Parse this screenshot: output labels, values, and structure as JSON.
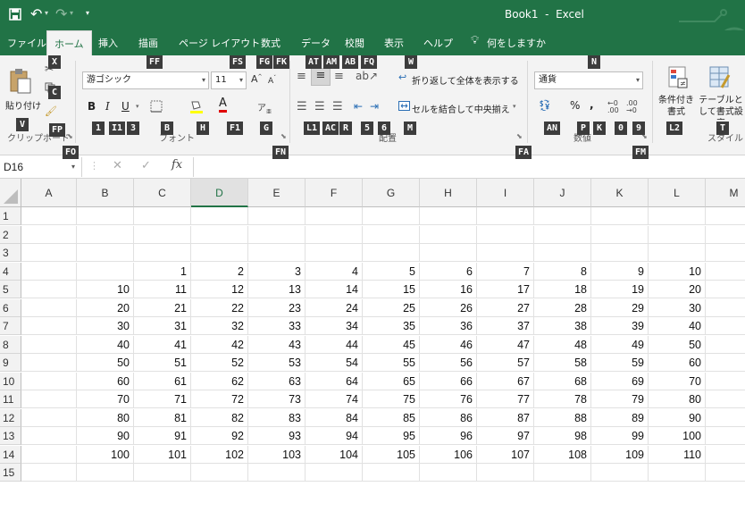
{
  "window": {
    "title": "Book1  -  Excel"
  },
  "menu": {
    "items": [
      "ファイル",
      "ホーム",
      "挿入",
      "描画",
      "ページ レイアウト",
      "数式",
      "データ",
      "校閲",
      "表示",
      "ヘルプ"
    ],
    "search": "何をしますか"
  },
  "keytips": {
    "menu": [
      "FF",
      "FS",
      "FG",
      "FK",
      "AT",
      "AM",
      "AB",
      "FQ",
      "W",
      "N"
    ],
    "ribbon": [
      "X",
      "C",
      "FP",
      "V",
      "1",
      "I1",
      "3",
      "B",
      "H",
      "F1",
      "G",
      "FN",
      "L1",
      "AC",
      "R",
      "5",
      "6",
      "M",
      "FA",
      "AN",
      "P",
      "K",
      "0",
      "9",
      "FM",
      "L2",
      "T",
      "FO"
    ]
  },
  "ribbon": {
    "clipboard": {
      "paste": "貼り付け",
      "label": "クリップボード"
    },
    "font": {
      "name": "游ゴシック",
      "size": "11",
      "label": "フォント"
    },
    "alignment": {
      "wrap": "折り返して全体を表示する",
      "merge": "セルを結合して中央揃え",
      "label": "配置"
    },
    "number": {
      "format": "通貨",
      "label": "数値"
    },
    "styles": {
      "conditional": "条件付き書式",
      "table": "テーブルとして書式設定",
      "label": "スタイル"
    }
  },
  "formula_bar": {
    "name_box": "D16",
    "fx": "fx",
    "value": ""
  },
  "sheet": {
    "columns": [
      "A",
      "B",
      "C",
      "D",
      "E",
      "F",
      "G",
      "H",
      "I",
      "J",
      "K",
      "L",
      "M"
    ],
    "selected_column": "D",
    "row_numbers": [
      "1",
      "2",
      "3",
      "4",
      "5",
      "6",
      "7",
      "8",
      "9",
      "10",
      "11",
      "12",
      "13",
      "14",
      "15"
    ],
    "cells": [
      [],
      [],
      [],
      [
        "",
        "",
        "1",
        "2",
        "3",
        "4",
        "5",
        "6",
        "7",
        "8",
        "9",
        "10"
      ],
      [
        "",
        "10",
        "11",
        "12",
        "13",
        "14",
        "15",
        "16",
        "17",
        "18",
        "19",
        "20"
      ],
      [
        "",
        "20",
        "21",
        "22",
        "23",
        "24",
        "25",
        "26",
        "27",
        "28",
        "29",
        "30"
      ],
      [
        "",
        "30",
        "31",
        "32",
        "33",
        "34",
        "35",
        "36",
        "37",
        "38",
        "39",
        "40"
      ],
      [
        "",
        "40",
        "41",
        "42",
        "43",
        "44",
        "45",
        "46",
        "47",
        "48",
        "49",
        "50"
      ],
      [
        "",
        "50",
        "51",
        "52",
        "53",
        "54",
        "55",
        "56",
        "57",
        "58",
        "59",
        "60"
      ],
      [
        "",
        "60",
        "61",
        "62",
        "63",
        "64",
        "65",
        "66",
        "67",
        "68",
        "69",
        "70"
      ],
      [
        "",
        "70",
        "71",
        "72",
        "73",
        "74",
        "75",
        "76",
        "77",
        "78",
        "79",
        "80"
      ],
      [
        "",
        "80",
        "81",
        "82",
        "83",
        "84",
        "85",
        "86",
        "87",
        "88",
        "89",
        "90"
      ],
      [
        "",
        "90",
        "91",
        "92",
        "93",
        "94",
        "95",
        "96",
        "97",
        "98",
        "99",
        "100"
      ],
      [
        "",
        "100",
        "101",
        "102",
        "103",
        "104",
        "105",
        "106",
        "107",
        "108",
        "109",
        "110"
      ],
      []
    ]
  },
  "colors": {
    "excel_green": "#217346",
    "keytip_bg": "#3c3c3c",
    "font_color_red": "#e00000"
  }
}
